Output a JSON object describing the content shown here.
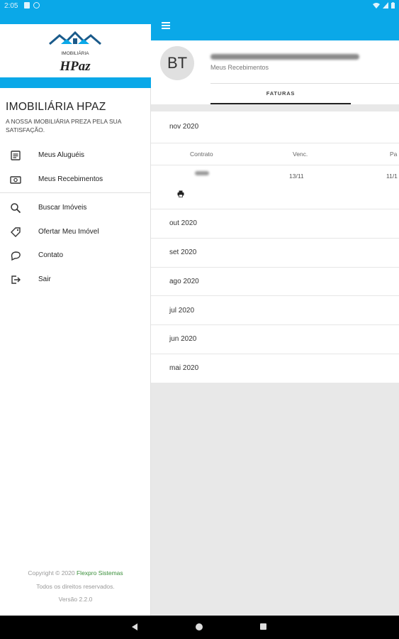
{
  "status_bar": {
    "time": "2:05"
  },
  "drawer": {
    "logo_top": "IMOBILIÁRIA",
    "logo_main": "HPaz",
    "brand": "IMOBILIÁRIA HPAZ",
    "tagline": "A NOSSA IMOBILIÁRIA PREZA PELA SUA SATISFAÇÃO.",
    "items": [
      {
        "label": "Meus Aluguéis",
        "icon": "document-icon"
      },
      {
        "label": "Meus Recebimentos",
        "icon": "money-icon"
      },
      {
        "label": "Buscar Imóveis",
        "icon": "search-icon"
      },
      {
        "label": "Ofertar Meu Imóvel",
        "icon": "tag-icon"
      },
      {
        "label": "Contato",
        "icon": "chat-icon"
      },
      {
        "label": "Sair",
        "icon": "logout-icon"
      }
    ],
    "footer": {
      "copyright_prefix": "Copyright © 2020",
      "company": "Flexpro Sistemas",
      "rights": "Todos os direitos reservados.",
      "version": "Versão 2.2.0"
    }
  },
  "profile": {
    "initials": "BT",
    "subtitle": "Meus Recebimentos",
    "tab": "FATURAS"
  },
  "invoices": {
    "expanded_month": "nov 2020",
    "columns": [
      "Contrato",
      "Venc.",
      "Pa"
    ],
    "row": {
      "due": "13/11",
      "paid": "11/1"
    },
    "months": [
      "out 2020",
      "set 2020",
      "ago 2020",
      "jul 2020",
      "jun 2020",
      "mai 2020"
    ]
  },
  "colors": {
    "primary": "#0aa8e8",
    "footer_link": "#3a8f3a"
  }
}
